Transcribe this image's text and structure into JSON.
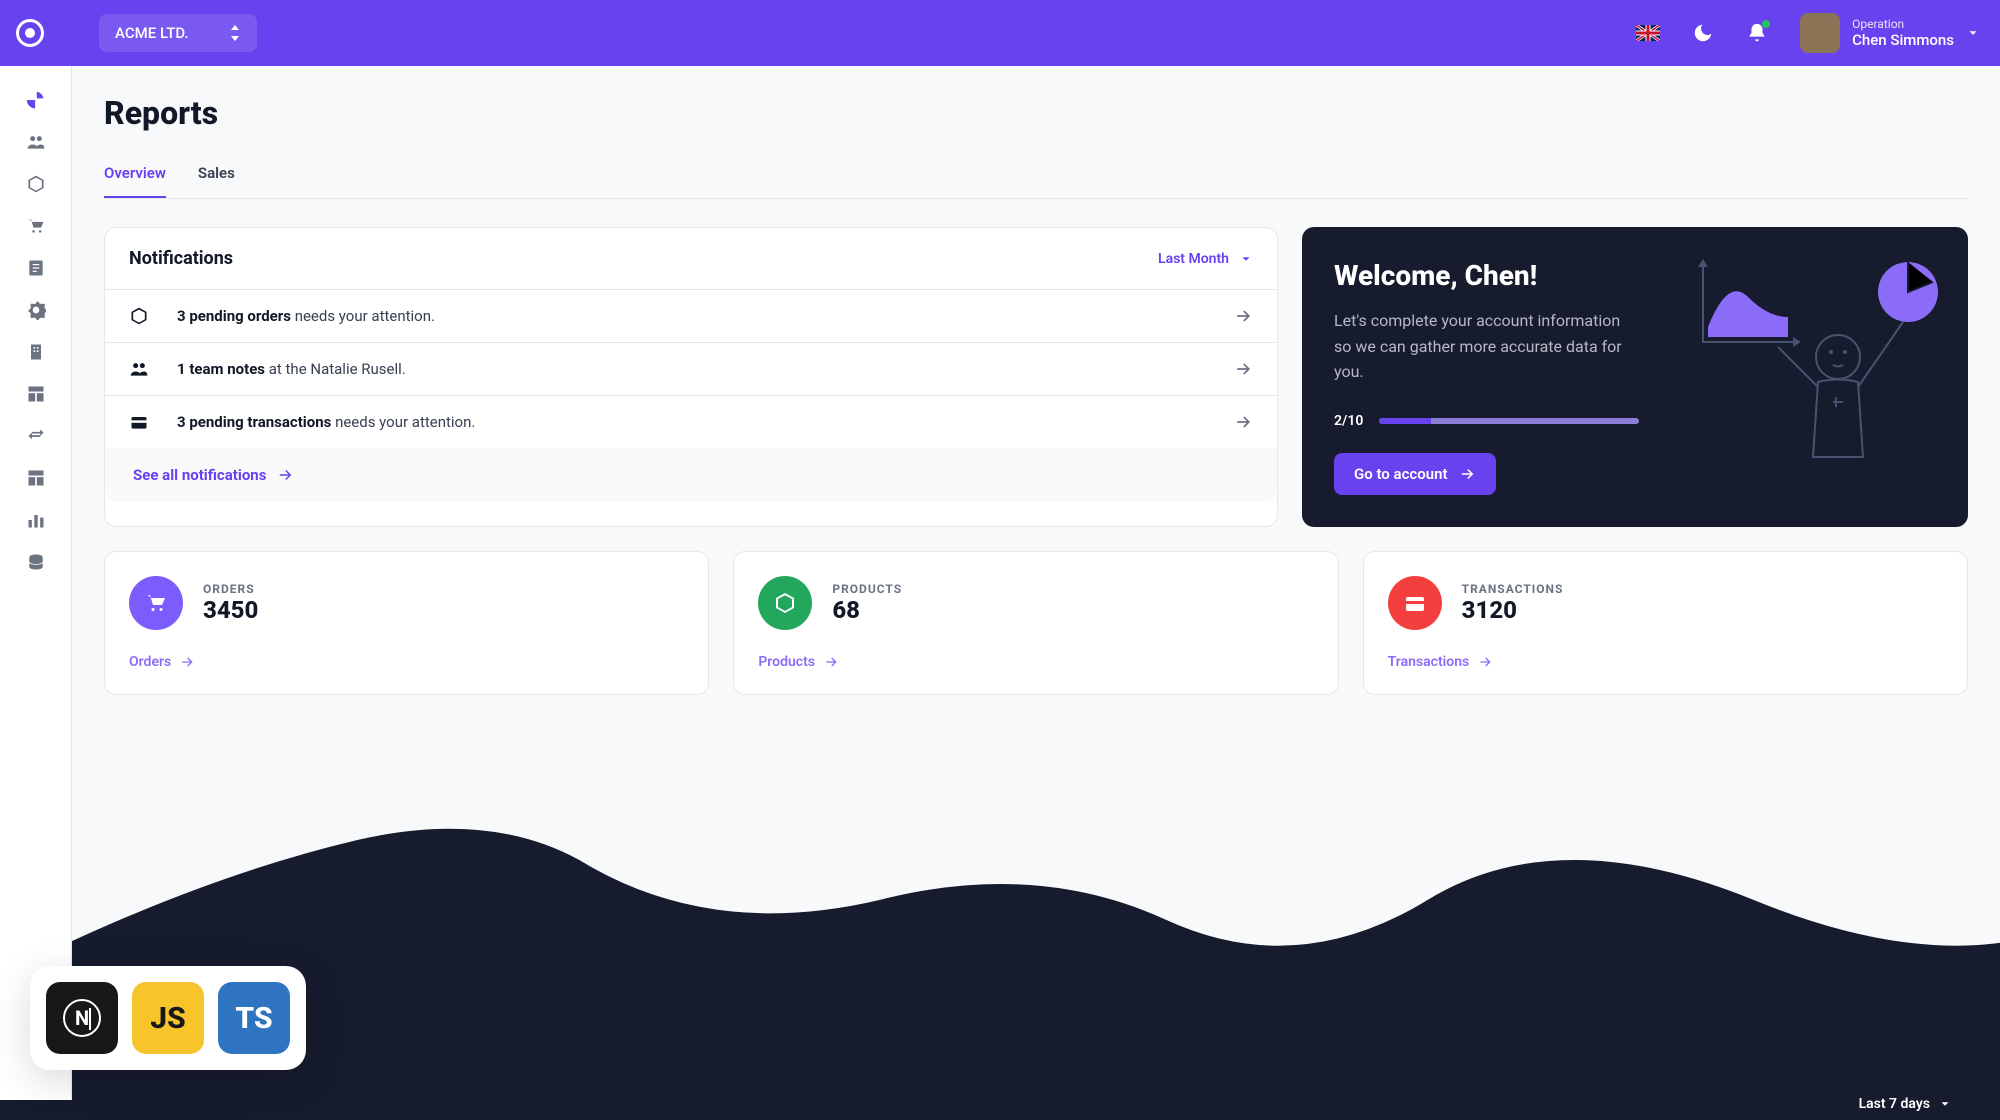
{
  "header": {
    "org": "ACME LTD.",
    "user_role": "Operation",
    "user_name": "Chen Simmons"
  },
  "page_title": "Reports",
  "tabs": [
    {
      "label": "Overview",
      "active": true
    },
    {
      "label": "Sales",
      "active": false
    }
  ],
  "notifications": {
    "title": "Notifications",
    "filter": "Last Month",
    "items": [
      {
        "bold": "3 pending orders",
        "rest": " needs your attention.",
        "icon": "box"
      },
      {
        "bold": "1 team notes",
        "rest": " at the Natalie Rusell.",
        "icon": "people"
      },
      {
        "bold": "3 pending transactions",
        "rest": " needs your attention.",
        "icon": "wallet"
      }
    ],
    "see_all": "See all notifications"
  },
  "welcome": {
    "title": "Welcome, Chen!",
    "desc": "Let's complete your account information so we can gather more accurate data for you.",
    "progress_text": "2/10",
    "progress_percent": 20,
    "button": "Go to account"
  },
  "stats": [
    {
      "label": "ORDERS",
      "value": "3450",
      "link": "Orders",
      "color": "purple",
      "icon": "cart"
    },
    {
      "label": "PRODUCTS",
      "value": "68",
      "link": "Products",
      "color": "green",
      "icon": "box"
    },
    {
      "label": "TRANSACTIONS",
      "value": "3120",
      "link": "Transactions",
      "color": "red",
      "icon": "card"
    }
  ],
  "chart_filter": "Last 7 days",
  "tech_badges": [
    "N",
    "JS",
    "TS"
  ]
}
